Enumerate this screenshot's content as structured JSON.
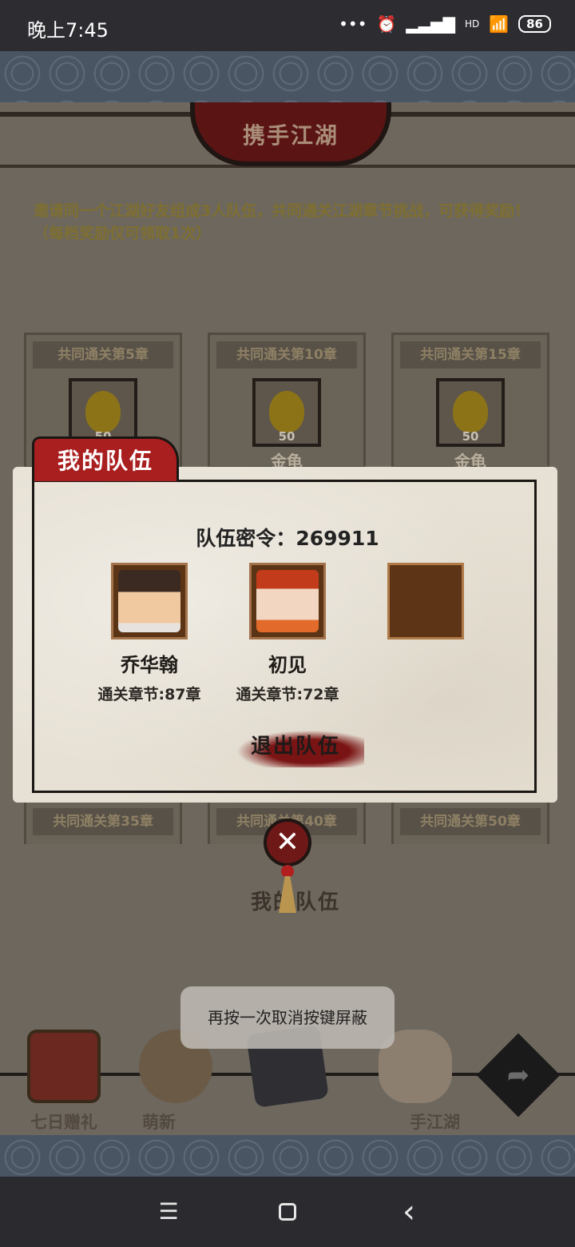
{
  "status_bar": {
    "time": "晚上7:45",
    "dots": "•••",
    "alarm": "⏰",
    "signal1": "▂▃▅▇",
    "signal2_hd": "HD",
    "wifi": "📶",
    "battery": "86"
  },
  "scene": {
    "title": "携手江湖",
    "intro": "邀请同一个江湖好友组成3人队伍，共同通关江湖章节挑战，可获得奖励！（每档奖励仅可领取1次）",
    "reward_cards_top": [
      {
        "chapter": "共同通关第5章",
        "qty": "50",
        "item": ""
      },
      {
        "chapter": "共同通关第10章",
        "qty": "50",
        "item": "金龟"
      },
      {
        "chapter": "共同通关第15章",
        "qty": "50",
        "item": "金龟"
      }
    ],
    "reward_cards_bottom": [
      {
        "chapter": "共同通关第35章"
      },
      {
        "chapter": "共同通关第40章"
      },
      {
        "chapter": "共同通关第50章"
      }
    ],
    "close_glyph": "✕",
    "my_team_label": "我的队伍",
    "nav": [
      {
        "label": "七日赠礼"
      },
      {
        "label": "萌新"
      },
      {
        "label": ""
      },
      {
        "label": "手江湖"
      }
    ],
    "share_glyph": "➦"
  },
  "modal": {
    "tab_label": "我的队伍",
    "team_code_label": "队伍密令：",
    "team_code": "269911",
    "members": [
      {
        "name": "乔华翰",
        "chapter": "通关章节:87章"
      },
      {
        "name": "初见",
        "chapter": "通关章节:72章"
      }
    ],
    "exit_label": "退出队伍"
  },
  "toast": {
    "text": "再按一次取消按键屏蔽"
  },
  "system_nav": {
    "menu": "☰",
    "back": "‹"
  },
  "colors": {
    "accent_red": "#a91e1e",
    "paper": "#e7e1d5",
    "slot_brown": "#5b3416"
  }
}
